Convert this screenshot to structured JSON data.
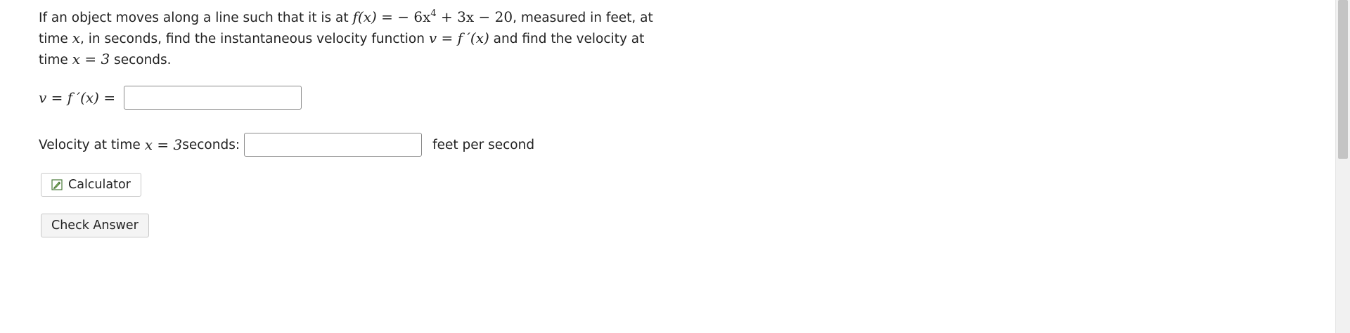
{
  "problem": {
    "text_1": "If an object moves along a line such that it is at ",
    "func_lhs": "f(x) = ",
    "func_rhs_a": "− 6x",
    "func_exp": "4",
    "func_rhs_b": " + 3x − 20",
    "text_2": ", measured in feet, at time ",
    "var_x": "x",
    "text_3": ", in seconds, find the instantaneous velocity function ",
    "vel_func": "v = f ′(x)",
    "text_4": " and find the velocity at time ",
    "time_eq": "x = 3",
    "text_5": " seconds."
  },
  "velocity_function": {
    "label_math": "v = f ′(x) =",
    "input_value": ""
  },
  "velocity_at_time": {
    "label_prefix": "Velocity at time ",
    "label_math": "x = 3",
    "label_suffix": " seconds:",
    "input_value": "",
    "unit": "feet per second"
  },
  "buttons": {
    "calculator": "Calculator",
    "check_answer": "Check Answer"
  },
  "icons": {
    "calculator": "pencil-edit-icon"
  }
}
